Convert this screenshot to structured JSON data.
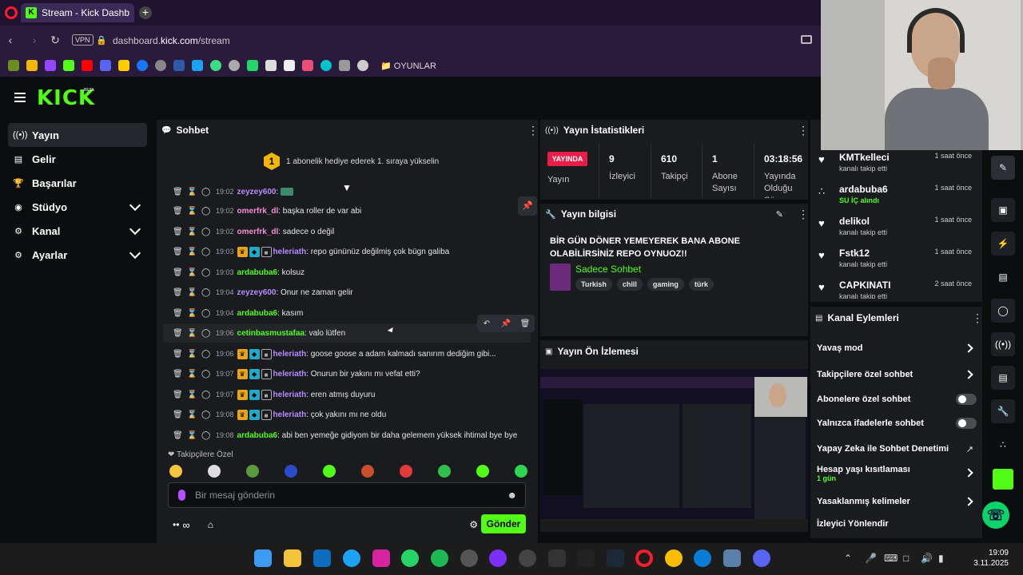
{
  "browser": {
    "tab_title": "Stream - Kick Dashboard",
    "vpn": "VPN",
    "url_prefix": "dashboard.",
    "url_domain": "kick.com",
    "url_path": "/stream",
    "bookmark_folder": "OYUNLAR"
  },
  "brand": {
    "logo": "KICK",
    "beta": "BETA",
    "accent": "#53fc18"
  },
  "sidebar": {
    "items": [
      {
        "label": "Yayın",
        "icon": "broadcast-icon",
        "active": true
      },
      {
        "label": "Gelir",
        "icon": "revenue-icon"
      },
      {
        "label": "Başarılar",
        "icon": "trophy-icon"
      },
      {
        "label": "Stüdyo",
        "icon": "studio-icon",
        "expandable": true
      },
      {
        "label": "Kanal",
        "icon": "channel-icon",
        "expandable": true
      },
      {
        "label": "Ayarlar",
        "icon": "settings-icon",
        "expandable": true
      }
    ]
  },
  "chat": {
    "title": "Sohbet",
    "hype_rank": "1",
    "hype_text": "1 abonelik hediye ederek 1. sıraya yükselin",
    "messages": [
      {
        "time": "19:02",
        "user": "zeyzey600",
        "text": "",
        "color": "purple"
      },
      {
        "time": "19:02",
        "user": "omerfrk_dl",
        "text": "başka roller de var abi",
        "color": "pink"
      },
      {
        "time": "19:02",
        "user": "omerfrk_dl",
        "text": "sadece o değil",
        "color": "pink"
      },
      {
        "time": "19:03",
        "user": "heleriath",
        "text": "repo gününüz değilmiş çok bügn galiba",
        "color": "purple",
        "badges": true
      },
      {
        "time": "19:03",
        "user": "ardabuba6",
        "text": "kolsuz",
        "color": "green"
      },
      {
        "time": "19:04",
        "user": "zeyzey600",
        "text": "Onur ne zaman gelir",
        "color": "purple"
      },
      {
        "time": "19:04",
        "user": "ardabuba6",
        "text": "kasım",
        "color": "green"
      },
      {
        "time": "19:06",
        "user": "cetinbasmustafaa",
        "text": "valo lütfen",
        "color": "green"
      },
      {
        "time": "19:06",
        "user": "heleriath",
        "text": "goose goose a adam kalmadı sanırım dediğim gibi...",
        "color": "purple",
        "badges": true
      },
      {
        "time": "19:07",
        "user": "heleriath",
        "text": "Onurun bir yakını mı vefat etti?",
        "color": "purple",
        "badges": true
      },
      {
        "time": "19:07",
        "user": "heleriath",
        "text": "eren atmış duyuru",
        "color": "purple",
        "badges": true
      },
      {
        "time": "19:08",
        "user": "heleriath",
        "text": "çok yakını mı ne oldu",
        "color": "purple",
        "badges": true
      },
      {
        "time": "19:08",
        "user": "ardabuba6",
        "text": "abi ben yemeğe gidiyom bir daha gelemem yüksek ihtimal bye bye",
        "color": "green"
      }
    ],
    "follower_only": "Takipçilere Özel",
    "input_placeholder": "Bir mesaj gönderin",
    "send_label": "Gönder"
  },
  "stats": {
    "title": "Yayın İstatistikleri",
    "live_badge": "YAYINDA",
    "stream_label": "Yayın",
    "cols": [
      {
        "value": "9",
        "label": "İzleyici"
      },
      {
        "value": "610",
        "label": "Takipçi"
      },
      {
        "value": "1",
        "label": "Abone Sayısı"
      },
      {
        "value": "03:18:56",
        "label": "Yayında Olduğu Süre"
      }
    ]
  },
  "stream_info": {
    "title": "Yayın bilgisi",
    "stream_title": "BİR GÜN DÖNER YEMEYEREK BANA ABONE OLABİLİRSİNİZ REPO OYNUOZ!!",
    "category": "Sadece Sohbet",
    "tags": [
      "Turkish",
      "chill",
      "gaming",
      "türk"
    ]
  },
  "preview": {
    "title": "Yayın Ön İzlemesi"
  },
  "activity": [
    {
      "name": "KMTkelleci",
      "sub": "kanalı takip etti",
      "time": "1 saat önce",
      "icon": "heart-icon"
    },
    {
      "name": "ardabuba6",
      "sub": "SU İÇ alındı",
      "time": "1 saat önce",
      "icon": "points-icon",
      "highlight": true
    },
    {
      "name": "delikol",
      "sub": "kanalı takip etti",
      "time": "1 saat önce",
      "icon": "heart-icon"
    },
    {
      "name": "Fstk12",
      "sub": "kanalı takip etti",
      "time": "1 saat önce",
      "icon": "heart-icon"
    },
    {
      "name": "CAPKINATI",
      "sub": "kanalı takip etti",
      "time": "2 saat önce",
      "icon": "heart-icon"
    }
  ],
  "channel_actions": {
    "title": "Kanal Eylemleri",
    "items": [
      {
        "label": "Yavaş mod",
        "type": "link"
      },
      {
        "label": "Takipçilere özel sohbet",
        "type": "link"
      },
      {
        "label": "Abonelere özel sohbet",
        "type": "toggle"
      },
      {
        "label": "Yalnızca ifadelerle sohbet",
        "type": "toggle"
      },
      {
        "label": "Yapay Zeka ile Sohbet Denetimi",
        "type": "external"
      },
      {
        "label": "Hesap yaşı kısıtlaması",
        "type": "link",
        "sub": "1 gün"
      },
      {
        "label": "Yasaklanmış kelimeler",
        "type": "link"
      },
      {
        "label": "İzleyici Yönlendir",
        "type": "plain"
      }
    ]
  },
  "taskbar": {
    "time": "19:09",
    "date": "3.11.2025"
  }
}
